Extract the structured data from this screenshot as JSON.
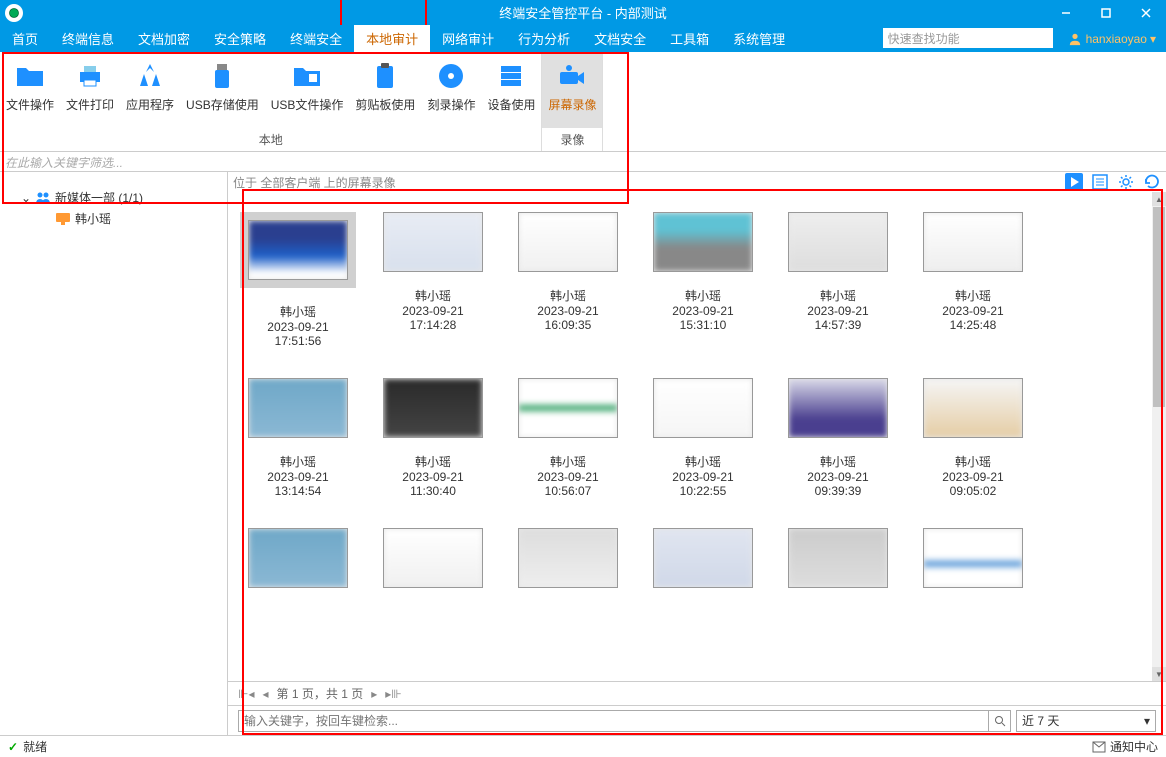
{
  "app": {
    "title": "终端安全管控平台 - 内部测试"
  },
  "menu": {
    "items": [
      "首页",
      "终端信息",
      "文档加密",
      "安全策略",
      "终端安全",
      "本地审计",
      "网络审计",
      "行为分析",
      "文档安全",
      "工具箱",
      "系统管理"
    ],
    "active_index": 5,
    "search_placeholder": "快速查找功能",
    "username": "hanxiaoyao"
  },
  "ribbon": {
    "group1": {
      "label": "本地",
      "buttons": [
        {
          "label": "文件操作",
          "icon": "folder"
        },
        {
          "label": "文件打印",
          "icon": "printer"
        },
        {
          "label": "应用程序",
          "icon": "apps"
        },
        {
          "label": "USB存储使用",
          "icon": "usb"
        },
        {
          "label": "USB文件操作",
          "icon": "usb-folder"
        },
        {
          "label": "剪贴板使用",
          "icon": "clipboard"
        },
        {
          "label": "刻录操作",
          "icon": "disc"
        },
        {
          "label": "设备使用",
          "icon": "server"
        }
      ]
    },
    "group2": {
      "label": "录像",
      "buttons": [
        {
          "label": "屏幕录像",
          "icon": "camera",
          "active": true
        }
      ]
    }
  },
  "filter_placeholder": "在此输入关键字筛选...",
  "sidebar": {
    "parent": {
      "label": "新媒体一部 (1/1)"
    },
    "child": {
      "label": "韩小瑶"
    }
  },
  "content": {
    "header_text": "位于  全部客户端  上的屏幕录像",
    "thumbnails": [
      {
        "name": "韩小瑶",
        "date": "2023-09-21",
        "time": "17:51:56",
        "selected": true
      },
      {
        "name": "韩小瑶",
        "date": "2023-09-21",
        "time": "17:14:28"
      },
      {
        "name": "韩小瑶",
        "date": "2023-09-21",
        "time": "16:09:35"
      },
      {
        "name": "韩小瑶",
        "date": "2023-09-21",
        "time": "15:31:10"
      },
      {
        "name": "韩小瑶",
        "date": "2023-09-21",
        "time": "14:57:39"
      },
      {
        "name": "韩小瑶",
        "date": "2023-09-21",
        "time": "14:25:48"
      },
      {
        "name": "韩小瑶",
        "date": "2023-09-21",
        "time": "13:14:54"
      },
      {
        "name": "韩小瑶",
        "date": "2023-09-21",
        "time": "11:30:40"
      },
      {
        "name": "韩小瑶",
        "date": "2023-09-21",
        "time": "10:56:07"
      },
      {
        "name": "韩小瑶",
        "date": "2023-09-21",
        "time": "10:22:55"
      },
      {
        "name": "韩小瑶",
        "date": "2023-09-21",
        "time": "09:39:39"
      },
      {
        "name": "韩小瑶",
        "date": "2023-09-21",
        "time": "09:05:02"
      },
      {
        "name": "",
        "date": "",
        "time": ""
      },
      {
        "name": "",
        "date": "",
        "time": ""
      },
      {
        "name": "",
        "date": "",
        "time": ""
      },
      {
        "name": "",
        "date": "",
        "time": ""
      },
      {
        "name": "",
        "date": "",
        "time": ""
      },
      {
        "name": "",
        "date": "",
        "time": ""
      }
    ],
    "pagination": "第 1 页，共 1 页",
    "search_placeholder": "输入关键字，按回车键检索...",
    "time_filter": "近 7 天"
  },
  "statusbar": {
    "status": "就绪",
    "notification": "通知中心"
  }
}
